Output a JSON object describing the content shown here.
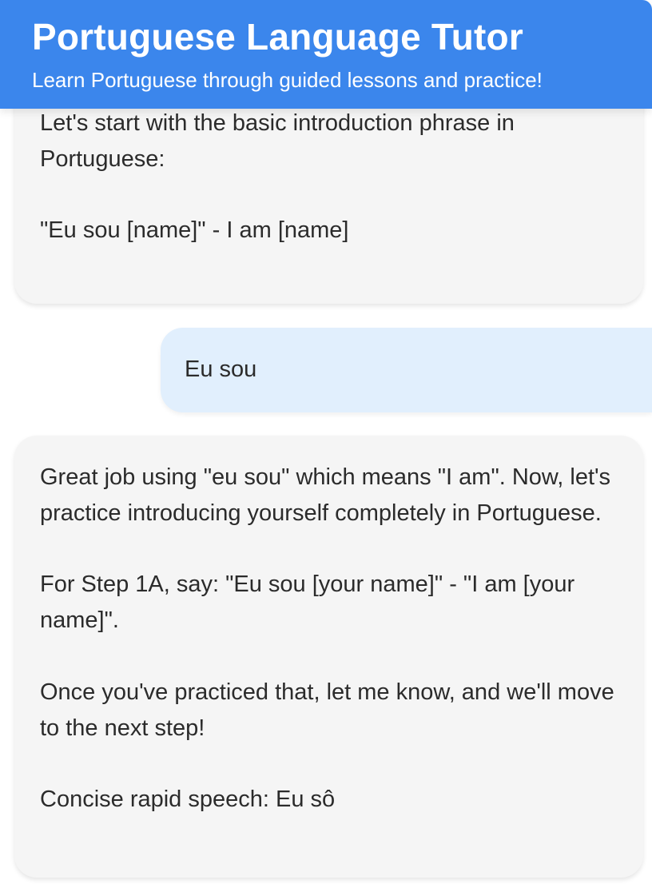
{
  "header": {
    "title": "Portuguese Language Tutor",
    "subtitle": "Learn Portuguese through guided lessons and practice!"
  },
  "colors": {
    "header_bg": "#3b86ec",
    "assistant_bubble_bg": "#f5f5f5",
    "user_bubble_bg": "#e1effd",
    "text": "#2b2b2b"
  },
  "messages": [
    {
      "role": "assistant",
      "text": "Let's start with the basic introduction phrase in Portuguese:\n\n\"Eu sou [name]\" - I am [name]"
    },
    {
      "role": "user",
      "text": "Eu sou"
    },
    {
      "role": "assistant",
      "text": "Great job using \"eu sou\" which means \"I am\". Now, let's practice introducing yourself completely in Portuguese.\n\nFor Step 1A, say: \"Eu sou [your name]\" - \"I am [your name]\".\n\nOnce you've practiced that, let me know, and we'll move to the next step!\n\nConcise rapid speech: Eu sô"
    }
  ]
}
